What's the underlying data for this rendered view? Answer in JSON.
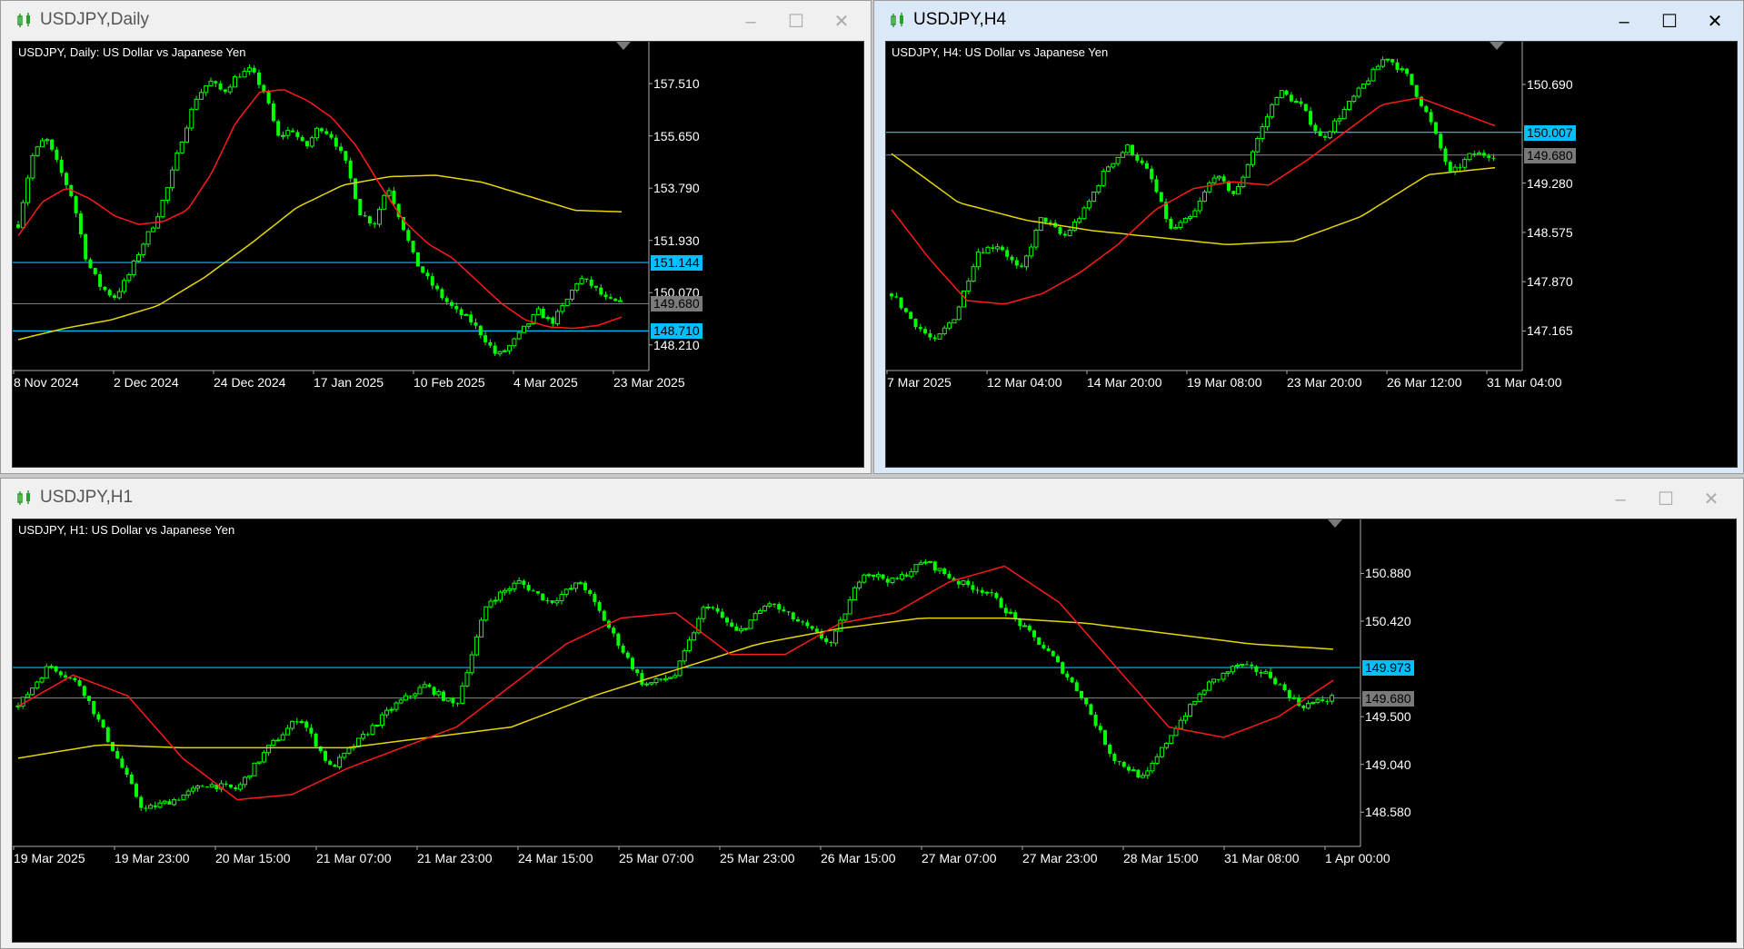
{
  "windows": [
    {
      "key": "daily",
      "title": "USDJPY,Daily",
      "legend": "USDJPY, Daily:  US Dollar vs Japanese Yen",
      "active": false,
      "controls": [
        "minimize",
        "maximize",
        "close"
      ],
      "price_labels": [
        "157.510",
        "155.650",
        "153.790",
        "151.930",
        "150.070",
        "148.210"
      ],
      "price_tags": [
        {
          "value": "151.144",
          "style": "blue"
        },
        {
          "value": "149.680",
          "style": "grey"
        },
        {
          "value": "148.710",
          "style": "blue"
        }
      ],
      "date_labels": [
        "8 Nov 2024",
        "2 Dec 2024",
        "24 Dec 2024",
        "17 Jan 2025",
        "10 Feb 2025",
        "4 Mar 2025",
        "23 Mar 2025"
      ]
    },
    {
      "key": "h4",
      "title": "USDJPY,H4",
      "legend": "USDJPY, H4:  US Dollar vs Japanese Yen",
      "active": true,
      "controls": [
        "minimize",
        "maximize",
        "close"
      ],
      "price_labels": [
        "150.690",
        "149.280",
        "148.575",
        "147.870",
        "147.165"
      ],
      "price_tags": [
        {
          "value": "150.007",
          "style": "blue"
        },
        {
          "value": "149.680",
          "style": "grey"
        }
      ],
      "date_labels": [
        "7 Mar 2025",
        "12 Mar 04:00",
        "14 Mar 20:00",
        "19 Mar 08:00",
        "23 Mar 20:00",
        "26 Mar 12:00",
        "31 Mar 04:00"
      ]
    },
    {
      "key": "h1",
      "title": "USDJPY,H1",
      "legend": "USDJPY, H1:  US Dollar vs Japanese Yen",
      "active": false,
      "controls": [
        "minimize",
        "maximize",
        "close"
      ],
      "price_labels": [
        "150.880",
        "150.420",
        "149.500",
        "149.040",
        "148.580"
      ],
      "price_tags": [
        {
          "value": "149.973",
          "style": "blue"
        },
        {
          "value": "149.680",
          "style": "grey"
        }
      ],
      "date_labels": [
        "19 Mar 2025",
        "19 Mar 23:00",
        "20 Mar 15:00",
        "21 Mar 07:00",
        "21 Mar 23:00",
        "24 Mar 15:00",
        "25 Mar 07:00",
        "25 Mar 23:00",
        "26 Mar 15:00",
        "27 Mar 07:00",
        "27 Mar 23:00",
        "28 Mar 15:00",
        "31 Mar 08:00",
        "1 Apr 00:00"
      ]
    }
  ],
  "colors": {
    "bull": "#00ff00",
    "ma_fast": "#ff1a1a",
    "ma_slow": "#e6d600",
    "hline": "#00bfff",
    "bidline": "#8a8a8a"
  },
  "chart_data": [
    {
      "type": "candlestick",
      "symbol": "USDJPY",
      "timeframe": "Daily",
      "ylim": [
        147.3,
        159.0
      ],
      "y_ticks": [
        157.51,
        155.65,
        153.79,
        151.93,
        150.07,
        148.21
      ],
      "horizontal_lines": [
        151.144,
        148.71
      ],
      "bid": 149.68,
      "x_labels": [
        "8 Nov 2024",
        "2 Dec 2024",
        "24 Dec 2024",
        "17 Jan 2025",
        "10 Feb 2025",
        "4 Mar 2025",
        "23 Mar 2025"
      ],
      "close_path": [
        152.5,
        154.9,
        155.6,
        154.5,
        153.4,
        151.2,
        150.3,
        149.9,
        150.6,
        151.7,
        152.6,
        153.9,
        155.6,
        157.0,
        157.6,
        157.2,
        157.8,
        158.0,
        157.2,
        155.6,
        155.9,
        155.2,
        156.0,
        155.6,
        154.6,
        152.9,
        152.5,
        153.9,
        152.6,
        151.2,
        150.5,
        149.9,
        149.4,
        149.1,
        148.5,
        147.8,
        148.2,
        148.8,
        149.4,
        149.0,
        149.7,
        150.6,
        150.3,
        149.8,
        149.68
      ],
      "ma_fast_path": [
        152.1,
        153.3,
        153.8,
        153.4,
        152.8,
        152.5,
        152.6,
        153.0,
        154.3,
        156.1,
        157.2,
        157.3,
        156.9,
        156.3,
        155.3,
        153.9,
        152.6,
        151.8,
        151.3,
        150.5,
        149.7,
        149.1,
        148.85,
        148.8,
        148.9,
        149.2
      ],
      "ma_slow_path": [
        148.4,
        148.8,
        149.1,
        149.6,
        150.6,
        151.8,
        153.1,
        153.9,
        154.2,
        154.25,
        154.0,
        153.5,
        153.0,
        152.95
      ]
    },
    {
      "type": "candlestick",
      "symbol": "USDJPY",
      "timeframe": "H4",
      "ylim": [
        146.6,
        151.3
      ],
      "y_ticks": [
        150.69,
        149.28,
        148.575,
        147.87,
        147.165
      ],
      "horizontal_lines": [
        150.007
      ],
      "bid": 149.68,
      "x_labels": [
        "7 Mar 2025",
        "12 Mar 04:00",
        "14 Mar 20:00",
        "19 Mar 08:00",
        "23 Mar 20:00",
        "26 Mar 12:00",
        "31 Mar 04:00"
      ],
      "close_path": [
        147.7,
        147.3,
        147.0,
        147.4,
        148.3,
        148.4,
        148.0,
        148.8,
        148.5,
        148.9,
        149.5,
        149.8,
        149.4,
        148.6,
        148.8,
        149.4,
        149.1,
        149.9,
        150.6,
        150.4,
        149.9,
        150.3,
        150.7,
        151.1,
        150.8,
        150.2,
        149.4,
        149.7,
        149.68
      ],
      "ma_fast_path": [
        148.9,
        148.2,
        147.6,
        147.55,
        147.7,
        148.0,
        148.4,
        148.9,
        149.2,
        149.3,
        149.25,
        149.6,
        150.0,
        150.4,
        150.5,
        150.3,
        150.1
      ],
      "ma_slow_path": [
        149.7,
        149.0,
        148.75,
        148.6,
        148.5,
        148.4,
        148.45,
        148.8,
        149.4,
        149.5
      ]
    },
    {
      "type": "candlestick",
      "symbol": "USDJPY",
      "timeframe": "H1",
      "ylim": [
        148.25,
        151.4
      ],
      "y_ticks": [
        150.88,
        150.42,
        149.5,
        149.04,
        148.58
      ],
      "horizontal_lines": [
        149.973
      ],
      "bid": 149.68,
      "x_labels": [
        "19 Mar 2025",
        "19 Mar 23:00",
        "20 Mar 15:00",
        "21 Mar 07:00",
        "21 Mar 23:00",
        "24 Mar 15:00",
        "25 Mar 07:00",
        "25 Mar 23:00",
        "26 Mar 15:00",
        "27 Mar 07:00",
        "27 Mar 23:00",
        "28 Mar 15:00",
        "31 Mar 08:00",
        "1 Apr 00:00"
      ],
      "close_path": [
        149.6,
        150.0,
        149.8,
        149.2,
        148.6,
        148.7,
        148.85,
        148.8,
        149.2,
        149.5,
        149.0,
        149.3,
        149.6,
        149.8,
        149.6,
        150.6,
        150.8,
        150.6,
        150.8,
        150.3,
        149.8,
        149.9,
        150.6,
        150.3,
        150.6,
        150.4,
        150.2,
        150.9,
        150.8,
        151.0,
        150.8,
        150.7,
        150.4,
        150.1,
        149.7,
        149.1,
        148.9,
        149.4,
        149.8,
        150.0,
        149.9,
        149.6,
        149.68
      ],
      "ma_fast_path": [
        149.6,
        149.9,
        149.7,
        149.1,
        148.7,
        148.75,
        149.0,
        149.2,
        149.4,
        149.8,
        150.2,
        150.45,
        150.5,
        150.1,
        150.1,
        150.4,
        150.5,
        150.8,
        150.95,
        150.6,
        150.0,
        149.4,
        149.3,
        149.5,
        149.85
      ],
      "ma_slow_path": [
        149.1,
        149.23,
        149.2,
        149.2,
        149.2,
        149.3,
        149.4,
        149.7,
        149.95,
        150.2,
        150.35,
        150.45,
        150.45,
        150.4,
        150.3,
        150.2,
        150.15
      ]
    }
  ]
}
